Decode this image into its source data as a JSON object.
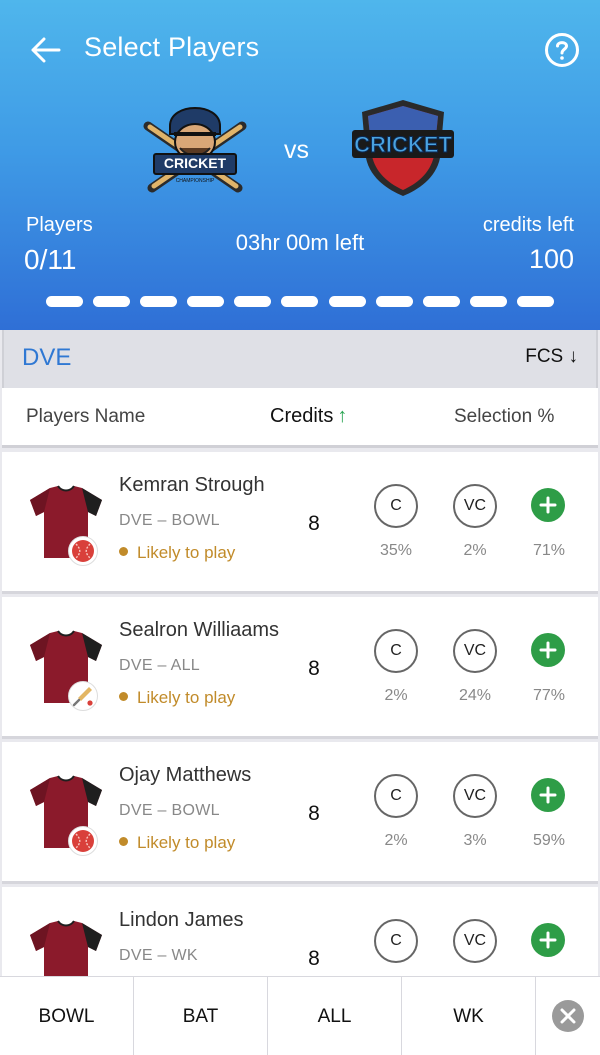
{
  "header": {
    "title": "Select Players",
    "vs_text": "vs",
    "players_label": "Players",
    "players_count": "0/11",
    "time_left": "03hr 00m left",
    "credits_label": "credits left",
    "credits_value": "100",
    "progress_total_slots": 11,
    "progress_filled_slots": 0,
    "gradient_top": "#4fb6ec",
    "gradient_bottom": "#2f6fd6",
    "team_left_logo_text": "CRICKET",
    "team_left_logo_subtext": "CHAMPIONSHIP",
    "team_right_logo_text": "CRICKET"
  },
  "team_bar": {
    "team_name": "DVE",
    "sort_label": "FCS ↓"
  },
  "columns": {
    "name": "Players Name",
    "credits": "Credits",
    "credits_sort_arrow": "↑",
    "selection": "Selection %"
  },
  "players": [
    {
      "name": "Kemran Strough",
      "team": "DVE",
      "role": "BOWL",
      "meta": "DVE – BOWL",
      "status": "Likely to play",
      "credits": "8",
      "captain_label": "C",
      "vice_captain_label": "VC",
      "captain_pct": "35%",
      "vice_captain_pct": "2%",
      "selection_pct": "71%",
      "role_icon": "ball-icon"
    },
    {
      "name": "Sealron Williaams",
      "team": "DVE",
      "role": "ALL",
      "meta": "DVE – ALL",
      "status": "Likely to play",
      "credits": "8",
      "captain_label": "C",
      "vice_captain_label": "VC",
      "captain_pct": "2%",
      "vice_captain_pct": "24%",
      "selection_pct": "77%",
      "role_icon": "bat-icon"
    },
    {
      "name": "Ojay Matthews",
      "team": "DVE",
      "role": "BOWL",
      "meta": "DVE – BOWL",
      "status": "Likely to play",
      "credits": "8",
      "captain_label": "C",
      "vice_captain_label": "VC",
      "captain_pct": "2%",
      "vice_captain_pct": "3%",
      "selection_pct": "59%",
      "role_icon": "ball-icon"
    },
    {
      "name": "Lindon James",
      "team": "DVE",
      "role": "WK",
      "meta": "DVE – WK",
      "status": "",
      "credits": "8",
      "captain_label": "C",
      "vice_captain_label": "VC",
      "captain_pct": "",
      "vice_captain_pct": "",
      "selection_pct": "",
      "role_icon": ""
    }
  ],
  "filters": {
    "tabs": [
      "BOWL",
      "BAT",
      "ALL",
      "WK"
    ],
    "close_icon": "close-icon"
  },
  "colors": {
    "accent_blue": "#2f78d3",
    "add_green": "#2e9d47",
    "status_gold": "#c18b2a",
    "jersey_maroon": "#8b1a2b"
  }
}
